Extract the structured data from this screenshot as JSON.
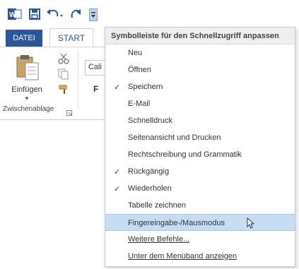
{
  "quick_access": {
    "icons": [
      "word-icon",
      "save-icon",
      "undo-icon",
      "redo-icon",
      "customize-qat-icon"
    ]
  },
  "ribbon": {
    "tabs": [
      {
        "label": "DATEI"
      },
      {
        "label": "START"
      }
    ],
    "clipboard": {
      "paste_label": "Einfügen",
      "group_label": "Zwischenablage"
    },
    "font": {
      "font_name": "Cali",
      "bold_label": "F"
    }
  },
  "menu": {
    "title": "Symbolleiste für den Schnellzugriff anpassen",
    "items": [
      {
        "label": "Neu",
        "checked": false
      },
      {
        "label": "Öffnen",
        "checked": false
      },
      {
        "label": "Speichern",
        "checked": true
      },
      {
        "label": "E-Mail",
        "checked": false
      },
      {
        "label": "Schnelldruck",
        "checked": false
      },
      {
        "label": "Seitenansicht und Drucken",
        "checked": false
      },
      {
        "label": "Rechtschreibung und Grammatik",
        "checked": false
      },
      {
        "label": "Rückgängig",
        "checked": true
      },
      {
        "label": "Wiederholen",
        "checked": true
      },
      {
        "label": "Tabelle zeichnen",
        "checked": false
      },
      {
        "label": "Fingereingabe-/Mausmodus",
        "checked": false,
        "highlighted": true
      },
      {
        "label": "Weitere Befehle...",
        "checked": false
      },
      {
        "label": "Unter dem Menüband anzeigen",
        "checked": false
      }
    ],
    "check_glyph": "✓"
  },
  "colors": {
    "accent": "#2b579a",
    "highlight": "#c5dcf2"
  }
}
